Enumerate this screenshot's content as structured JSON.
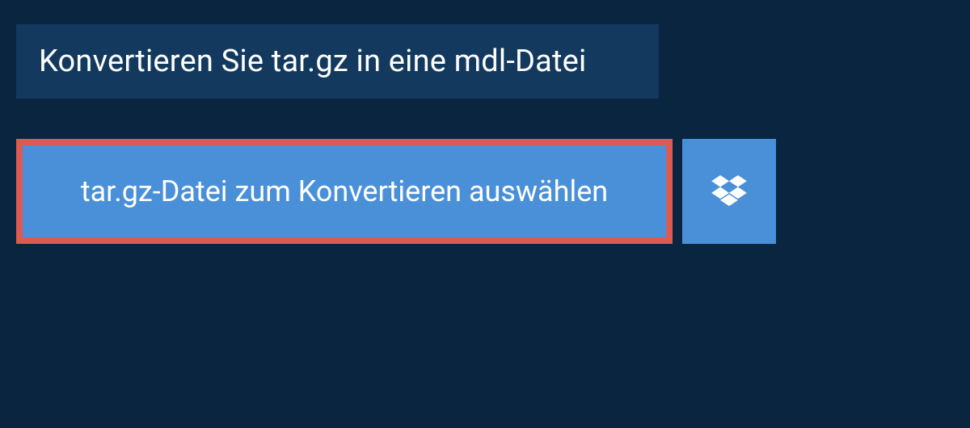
{
  "header": {
    "title": "Konvertieren Sie tar.gz in eine mdl-Datei"
  },
  "actions": {
    "select_file_label": "tar.gz-Datei zum Konvertieren auswählen"
  },
  "colors": {
    "background": "#0a2540",
    "header_background": "#133a5e",
    "button_primary": "#4a90d9",
    "button_border_highlight": "#d95b52",
    "text": "#ffffff"
  }
}
